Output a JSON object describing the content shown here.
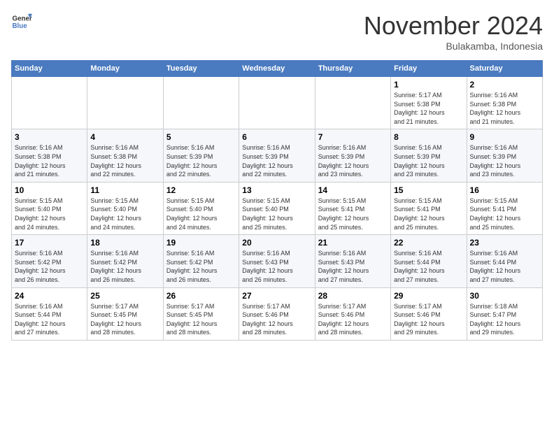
{
  "header": {
    "logo_line1": "General",
    "logo_line2": "Blue",
    "month": "November 2024",
    "location": "Bulakamba, Indonesia"
  },
  "days_of_week": [
    "Sunday",
    "Monday",
    "Tuesday",
    "Wednesday",
    "Thursday",
    "Friday",
    "Saturday"
  ],
  "weeks": [
    [
      {
        "day": "",
        "info": ""
      },
      {
        "day": "",
        "info": ""
      },
      {
        "day": "",
        "info": ""
      },
      {
        "day": "",
        "info": ""
      },
      {
        "day": "",
        "info": ""
      },
      {
        "day": "1",
        "info": "Sunrise: 5:17 AM\nSunset: 5:38 PM\nDaylight: 12 hours\nand 21 minutes."
      },
      {
        "day": "2",
        "info": "Sunrise: 5:16 AM\nSunset: 5:38 PM\nDaylight: 12 hours\nand 21 minutes."
      }
    ],
    [
      {
        "day": "3",
        "info": "Sunrise: 5:16 AM\nSunset: 5:38 PM\nDaylight: 12 hours\nand 21 minutes."
      },
      {
        "day": "4",
        "info": "Sunrise: 5:16 AM\nSunset: 5:38 PM\nDaylight: 12 hours\nand 22 minutes."
      },
      {
        "day": "5",
        "info": "Sunrise: 5:16 AM\nSunset: 5:39 PM\nDaylight: 12 hours\nand 22 minutes."
      },
      {
        "day": "6",
        "info": "Sunrise: 5:16 AM\nSunset: 5:39 PM\nDaylight: 12 hours\nand 22 minutes."
      },
      {
        "day": "7",
        "info": "Sunrise: 5:16 AM\nSunset: 5:39 PM\nDaylight: 12 hours\nand 23 minutes."
      },
      {
        "day": "8",
        "info": "Sunrise: 5:16 AM\nSunset: 5:39 PM\nDaylight: 12 hours\nand 23 minutes."
      },
      {
        "day": "9",
        "info": "Sunrise: 5:16 AM\nSunset: 5:39 PM\nDaylight: 12 hours\nand 23 minutes."
      }
    ],
    [
      {
        "day": "10",
        "info": "Sunrise: 5:15 AM\nSunset: 5:40 PM\nDaylight: 12 hours\nand 24 minutes."
      },
      {
        "day": "11",
        "info": "Sunrise: 5:15 AM\nSunset: 5:40 PM\nDaylight: 12 hours\nand 24 minutes."
      },
      {
        "day": "12",
        "info": "Sunrise: 5:15 AM\nSunset: 5:40 PM\nDaylight: 12 hours\nand 24 minutes."
      },
      {
        "day": "13",
        "info": "Sunrise: 5:15 AM\nSunset: 5:40 PM\nDaylight: 12 hours\nand 25 minutes."
      },
      {
        "day": "14",
        "info": "Sunrise: 5:15 AM\nSunset: 5:41 PM\nDaylight: 12 hours\nand 25 minutes."
      },
      {
        "day": "15",
        "info": "Sunrise: 5:15 AM\nSunset: 5:41 PM\nDaylight: 12 hours\nand 25 minutes."
      },
      {
        "day": "16",
        "info": "Sunrise: 5:15 AM\nSunset: 5:41 PM\nDaylight: 12 hours\nand 25 minutes."
      }
    ],
    [
      {
        "day": "17",
        "info": "Sunrise: 5:16 AM\nSunset: 5:42 PM\nDaylight: 12 hours\nand 26 minutes."
      },
      {
        "day": "18",
        "info": "Sunrise: 5:16 AM\nSunset: 5:42 PM\nDaylight: 12 hours\nand 26 minutes."
      },
      {
        "day": "19",
        "info": "Sunrise: 5:16 AM\nSunset: 5:42 PM\nDaylight: 12 hours\nand 26 minutes."
      },
      {
        "day": "20",
        "info": "Sunrise: 5:16 AM\nSunset: 5:43 PM\nDaylight: 12 hours\nand 26 minutes."
      },
      {
        "day": "21",
        "info": "Sunrise: 5:16 AM\nSunset: 5:43 PM\nDaylight: 12 hours\nand 27 minutes."
      },
      {
        "day": "22",
        "info": "Sunrise: 5:16 AM\nSunset: 5:44 PM\nDaylight: 12 hours\nand 27 minutes."
      },
      {
        "day": "23",
        "info": "Sunrise: 5:16 AM\nSunset: 5:44 PM\nDaylight: 12 hours\nand 27 minutes."
      }
    ],
    [
      {
        "day": "24",
        "info": "Sunrise: 5:16 AM\nSunset: 5:44 PM\nDaylight: 12 hours\nand 27 minutes."
      },
      {
        "day": "25",
        "info": "Sunrise: 5:17 AM\nSunset: 5:45 PM\nDaylight: 12 hours\nand 28 minutes."
      },
      {
        "day": "26",
        "info": "Sunrise: 5:17 AM\nSunset: 5:45 PM\nDaylight: 12 hours\nand 28 minutes."
      },
      {
        "day": "27",
        "info": "Sunrise: 5:17 AM\nSunset: 5:46 PM\nDaylight: 12 hours\nand 28 minutes."
      },
      {
        "day": "28",
        "info": "Sunrise: 5:17 AM\nSunset: 5:46 PM\nDaylight: 12 hours\nand 28 minutes."
      },
      {
        "day": "29",
        "info": "Sunrise: 5:17 AM\nSunset: 5:46 PM\nDaylight: 12 hours\nand 29 minutes."
      },
      {
        "day": "30",
        "info": "Sunrise: 5:18 AM\nSunset: 5:47 PM\nDaylight: 12 hours\nand 29 minutes."
      }
    ]
  ]
}
